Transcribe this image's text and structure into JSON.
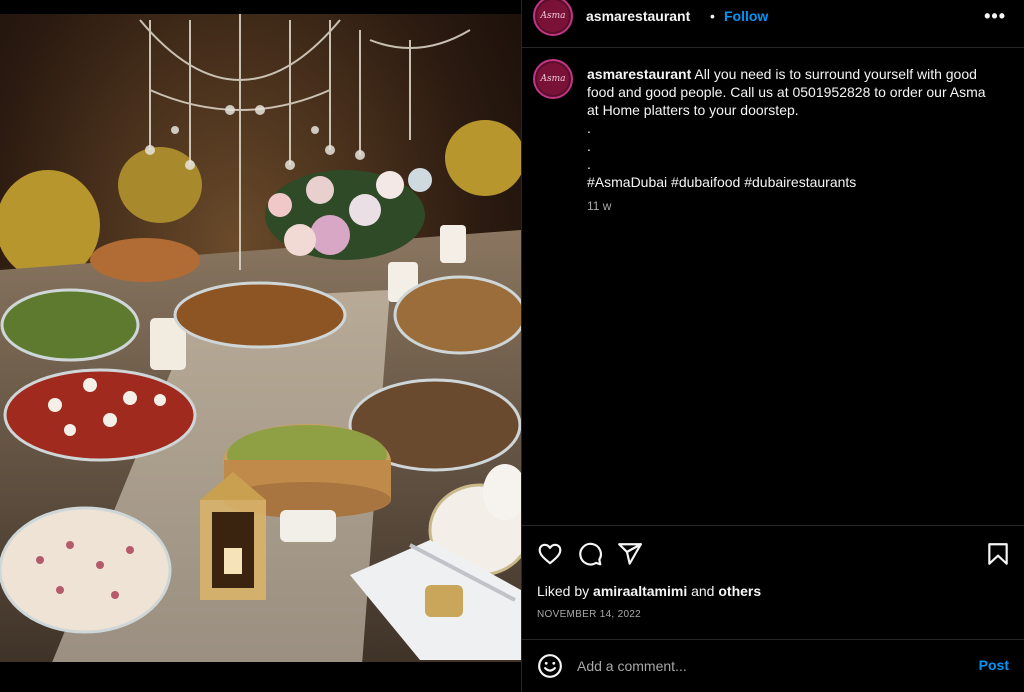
{
  "post": {
    "username": "asmarestaurant",
    "avatar_text": "Asma",
    "separator": "•",
    "follow_label": "Follow",
    "more_label": "•••",
    "photo_alt": "Banquet table with chandelier, flowers, lanterns and many dishes"
  },
  "caption": {
    "username": "asmarestaurant",
    "text": "All you need is to surround yourself with good food and good people. Call us at 0501952828 to order our Asma at Home platters to your doorstep.",
    "dots": [
      ".",
      ".",
      "."
    ],
    "hashtags": "#AsmaDubai #dubaifood #dubairestaurants",
    "time_ago": "11 w"
  },
  "actions": {
    "like_icon": "heart-icon",
    "comment_icon": "comment-icon",
    "share_icon": "share-icon",
    "save_icon": "bookmark-icon"
  },
  "likes": {
    "prefix": "Liked by",
    "user": "amiraaltamimi",
    "connector": "and",
    "others": "others"
  },
  "date": "NOVEMBER 14, 2022",
  "comment": {
    "emoji_icon": "emoji-icon",
    "placeholder": "Add a comment...",
    "post_label": "Post"
  },
  "colors": {
    "background": "#000000",
    "text": "#f5f5f5",
    "muted": "#a8a8a8",
    "link": "#0095f6",
    "divider": "#262626"
  }
}
